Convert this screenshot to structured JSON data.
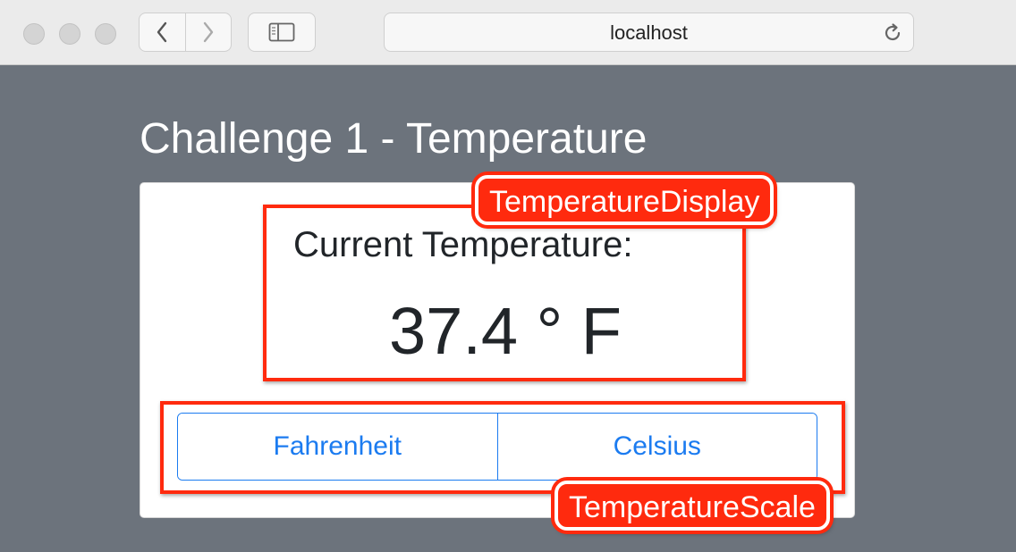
{
  "browser": {
    "url": "localhost",
    "traffic_lights": [
      "close",
      "minimize",
      "zoom"
    ],
    "back_icon": "chevron-left-icon",
    "forward_icon": "chevron-right-icon",
    "sidebar_icon": "sidebar-icon",
    "reload_icon": "reload-icon"
  },
  "page": {
    "title": "Challenge 1 - Temperature"
  },
  "display": {
    "label": "Current Temperature:",
    "value": "37.4 ° F"
  },
  "scale_buttons": [
    {
      "label": "Fahrenheit"
    },
    {
      "label": "Celsius"
    }
  ],
  "annotations": {
    "display": "TemperatureDisplay",
    "scale": "TemperatureScale"
  },
  "colors": {
    "background": "#6c737c",
    "accent": "#1b7bf0",
    "annotation": "#ff2a0e"
  }
}
